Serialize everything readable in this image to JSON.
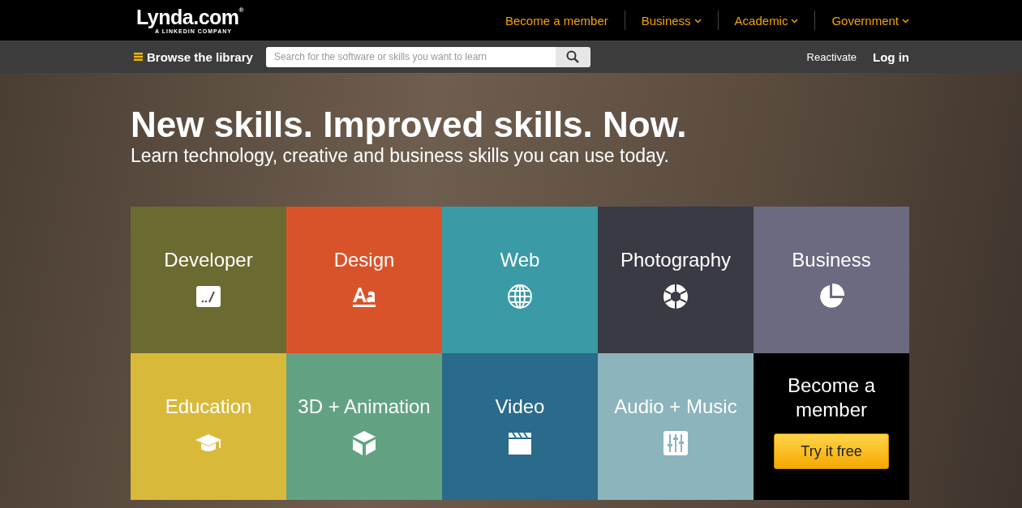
{
  "logo": {
    "name": "Lynda.com$^{®}$",
    "tagline": "A LINKEDIN COMPANY"
  },
  "top_nav": [
    {
      "label": "Become a member",
      "has_menu": false
    },
    {
      "label": "Business",
      "has_menu": true
    },
    {
      "label": "Academic",
      "has_menu": true
    },
    {
      "label": "Government",
      "has_menu": true
    }
  ],
  "toolbar": {
    "browse": "Browse the library",
    "search": {
      "placeholder": "Search for the software or skills you want to learn"
    },
    "links": [
      "Reactivate",
      "Log in"
    ]
  },
  "hero": {
    "title": "New skills. Improved skills. Now.",
    "subtitle": "Learn technology, creative and business skills you can use today."
  },
  "tiles": [
    {
      "label": "Developer",
      "color": "#6b6a30"
    },
    {
      "label": "Design",
      "color": "#d9532a"
    },
    {
      "label": "Web",
      "color": "#3a9aa5"
    },
    {
      "label": "Photography",
      "color": "#3a3a45"
    },
    {
      "label": "Business",
      "color": "#6c6a80"
    },
    {
      "label": "Education",
      "color": "#d9b93a"
    },
    {
      "label": "3D + Animation",
      "color": "#62a282"
    },
    {
      "label": "Video",
      "color": "#2a6a8a"
    },
    {
      "label": "Audio + Music",
      "color": "#8bb4bc"
    }
  ],
  "member_tile": {
    "title": "Become a member",
    "button": "Try it free"
  }
}
